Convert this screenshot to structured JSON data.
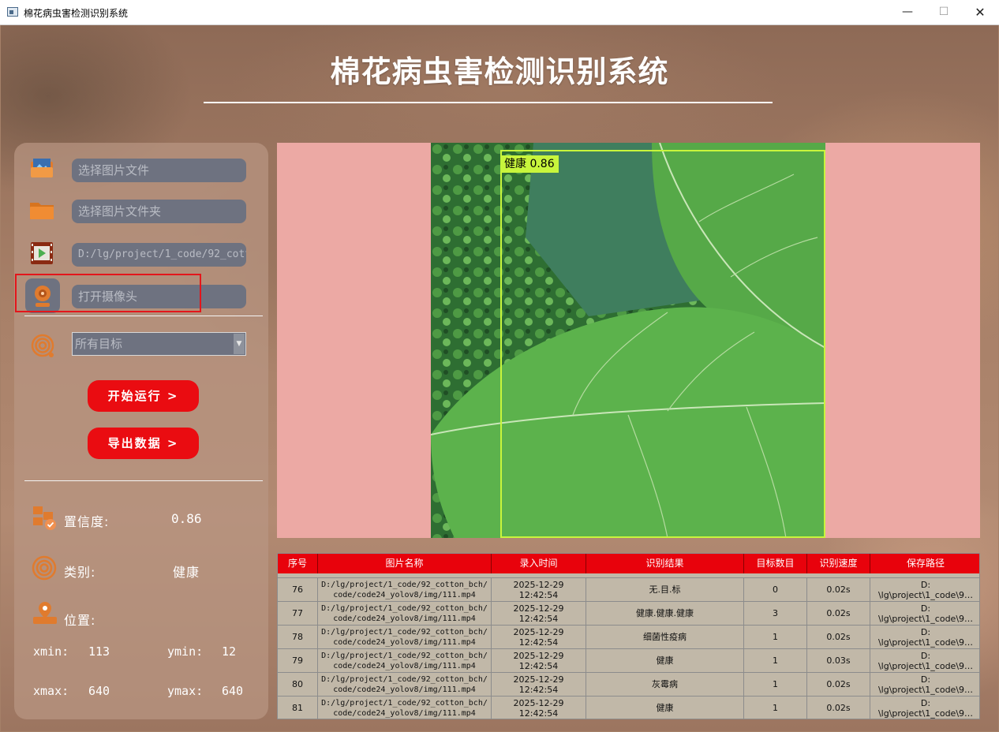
{
  "window": {
    "title": "棉花病虫害检测识别系统",
    "minimize": "—",
    "maximize": "☐",
    "close": "✕"
  },
  "header": {
    "title": "棉花病虫害检测识别系统"
  },
  "inputs": {
    "image_file": "选择图片文件",
    "image_folder": "选择图片文件夹",
    "video_path": "D:/lg/project/1_code/92_cotton_bch/",
    "camera": "打开摄像头",
    "target_select": "所有目标"
  },
  "buttons": {
    "start": "开始运行 >",
    "export": "导出数据 >"
  },
  "info": {
    "confidence_label": "置信度:",
    "confidence_value": "0.86",
    "class_label": "类别:",
    "class_value": "健康",
    "position_label": "位置:",
    "xmin_label": "xmin:",
    "xmin_value": "113",
    "ymin_label": "ymin:",
    "ymin_value": "12",
    "xmax_label": "xmax:",
    "xmax_value": "640",
    "ymax_label": "ymax:",
    "ymax_value": "640"
  },
  "detection": {
    "label": "健康 0.86",
    "box_color": "#c8f53c"
  },
  "table": {
    "headers": [
      "序号",
      "图片名称",
      "录入时间",
      "识别结果",
      "目标数目",
      "识别速度",
      "保存路径"
    ],
    "rows": [
      [
        "76",
        "D:/lg/project/1_code/92_cotton_bch/\ncode/code24_yolov8/img/111.mp4",
        "2025-12-29\n12:42:54",
        "无.目.标",
        "0",
        "0.02s",
        "D:\n\\lg\\project\\1_code\\9…"
      ],
      [
        "77",
        "D:/lg/project/1_code/92_cotton_bch/\ncode/code24_yolov8/img/111.mp4",
        "2025-12-29\n12:42:54",
        "健康.健康.健康",
        "3",
        "0.02s",
        "D:\n\\lg\\project\\1_code\\9…"
      ],
      [
        "78",
        "D:/lg/project/1_code/92_cotton_bch/\ncode/code24_yolov8/img/111.mp4",
        "2025-12-29\n12:42:54",
        "细菌性疫病",
        "1",
        "0.02s",
        "D:\n\\lg\\project\\1_code\\9…"
      ],
      [
        "79",
        "D:/lg/project/1_code/92_cotton_bch/\ncode/code24_yolov8/img/111.mp4",
        "2025-12-29\n12:42:54",
        "健康",
        "1",
        "0.03s",
        "D:\n\\lg\\project\\1_code\\9…"
      ],
      [
        "80",
        "D:/lg/project/1_code/92_cotton_bch/\ncode/code24_yolov8/img/111.mp4",
        "2025-12-29\n12:42:54",
        "灰霉病",
        "1",
        "0.02s",
        "D:\n\\lg\\project\\1_code\\9…"
      ],
      [
        "81",
        "D:/lg/project/1_code/92_cotton_bch/\ncode/code24_yolov8/img/111.mp4",
        "2025-12-29\n12:42:54",
        "健康",
        "1",
        "0.02s",
        "D:\n\\lg\\project\\1_code\\9…"
      ]
    ]
  },
  "colors": {
    "accent_red": "#ea0c11",
    "field_bg": "#6e7280",
    "display_bg": "#eca9a4",
    "table_header": "#e8020c"
  },
  "icons": [
    "image-file-icon",
    "folder-icon",
    "video-icon",
    "camera-icon",
    "target-icon",
    "confidence-icon",
    "class-icon",
    "location-icon"
  ]
}
